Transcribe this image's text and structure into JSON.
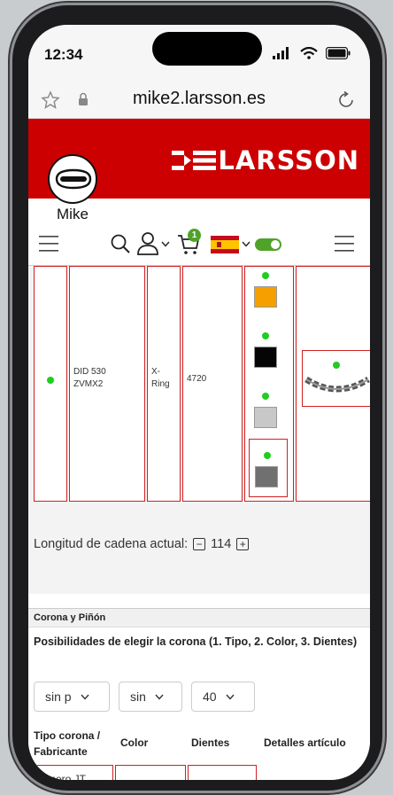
{
  "status": {
    "time": "12:34"
  },
  "browser": {
    "url": "mike2.larsson.es"
  },
  "brand": {
    "logo_text": "LARSSON",
    "color": "#cc0000"
  },
  "user": {
    "name": "Mike"
  },
  "nav": {
    "cart_count": "1",
    "flag": "Spain",
    "toggle_on": true
  },
  "chain_row": {
    "model": "DID 530 ZVMX2",
    "type": "X-Ring",
    "code": "4720",
    "colors": [
      "#f5a000",
      "#050505",
      "#c8c8c8",
      "#707070"
    ],
    "selected_color_index": 3
  },
  "length": {
    "label": "Longitud de cadena actual:",
    "value": "114",
    "minus": "−",
    "plus": "+"
  },
  "corona": {
    "section_title": "Corona y Piñón",
    "heading": "Posibilidades de elegir la corona (1. Tipo, 2. Color, 3. Dientes)",
    "selects": [
      "sin p",
      "sin",
      "40"
    ],
    "columns": [
      "Tipo corona / Fabricante",
      "Color",
      "Dientes",
      "Detalles artículo"
    ],
    "first_cell": "Acero JT"
  }
}
